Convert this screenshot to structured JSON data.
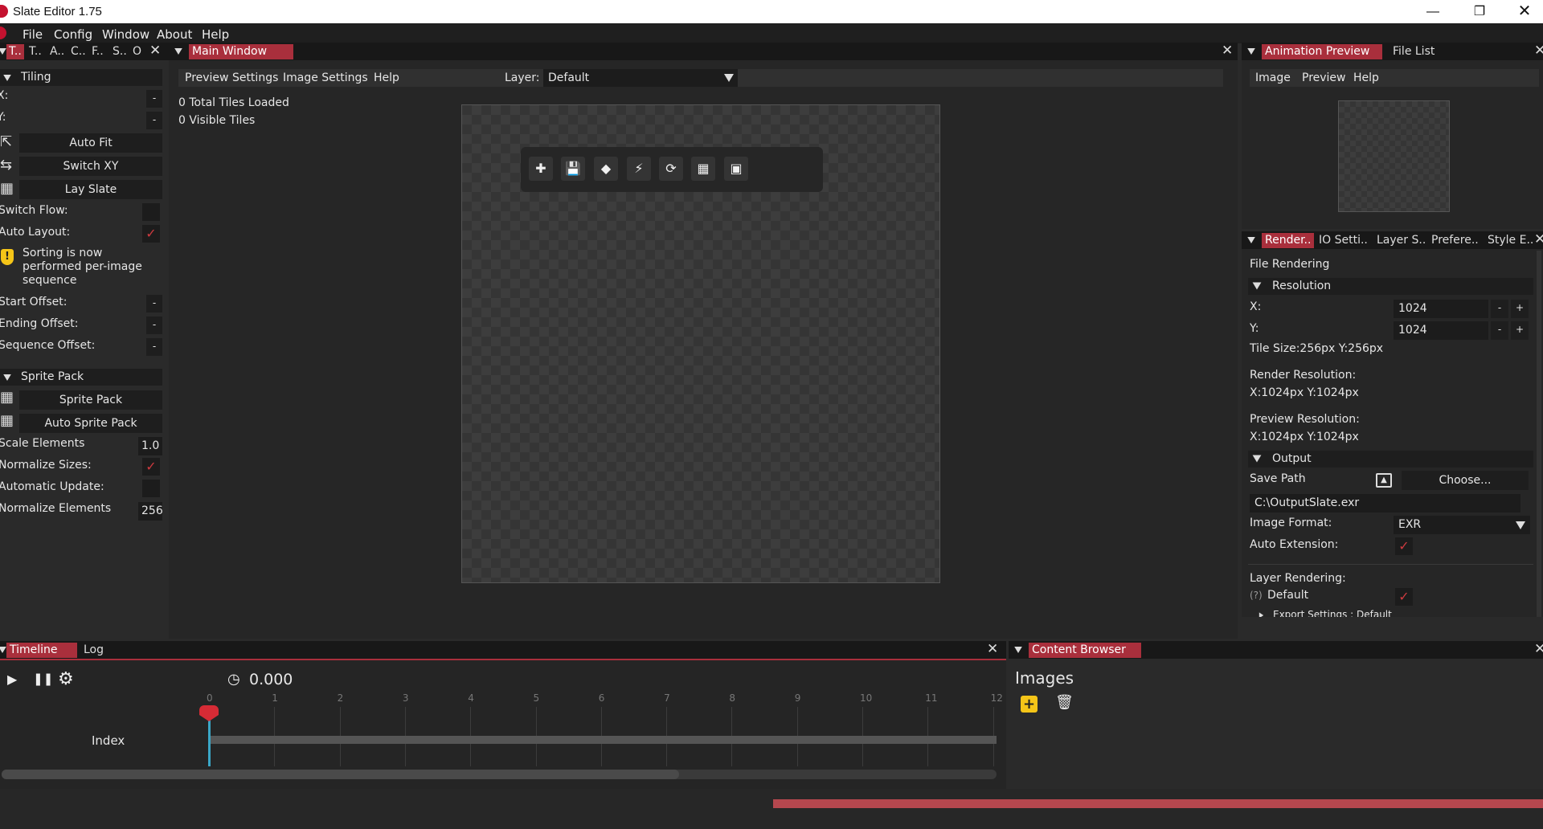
{
  "app": {
    "title": "Slate Editor 1.75"
  },
  "menu": [
    "File",
    "Config",
    "Window",
    "About",
    "Help"
  ],
  "left_tabs": [
    "T..",
    "T..",
    "A..",
    "C..",
    "F..",
    "S..",
    "O"
  ],
  "tiling": {
    "header": "Tiling",
    "x_label": "X:",
    "y_label": "Y:",
    "minus": "-",
    "auto_fit": "Auto Fit",
    "switch_xy": "Switch XY",
    "lay_slate": "Lay Slate",
    "switch_flow": "Switch Flow:",
    "auto_layout": "Auto Layout:",
    "warning": "Sorting is now performed per-image sequence",
    "start_offset": "Start Offset:",
    "ending_offset": "Ending Offset:",
    "sequence_offset": "Sequence Offset:"
  },
  "sprite_pack": {
    "header": "Sprite Pack",
    "sprite_pack_btn": "Sprite Pack",
    "auto_sprite_pack_btn": "Auto Sprite Pack",
    "scale_elements": "Scale Elements",
    "scale_value": "1.0",
    "normalize_sizes": "Normalize Sizes:",
    "automatic_update": "Automatic Update:",
    "normalize_elements": "Normalize Elements",
    "normalize_value": "256"
  },
  "main_window": {
    "tab": "Main Window",
    "menu": [
      "Preview Settings",
      "Image Settings",
      "Help"
    ],
    "layer_label": "Layer:",
    "layer_value": "Default",
    "tiles_loaded": "0 Total Tiles Loaded",
    "visible_tiles": "0 Visible Tiles"
  },
  "right_top": {
    "tabs": [
      "Animation Preview",
      "File List"
    ],
    "menu": [
      "Image",
      "Preview",
      "Help"
    ]
  },
  "right_panel": {
    "tabs": [
      "Render..",
      "IO Setti..",
      "Layer S..",
      "Prefere..",
      "Style E.."
    ],
    "file_rendering": "File Rendering",
    "resolution_header": "Resolution",
    "x_label": "X:",
    "x_value": "1024",
    "y_label": "Y:",
    "y_value": "1024",
    "minus": "-",
    "plus": "+",
    "tile_size": "Tile Size:256px  Y:256px",
    "render_resolution_label": "Render Resolution:",
    "render_resolution_value": "X:1024px  Y:1024px",
    "preview_resolution_label": "Preview Resolution:",
    "preview_resolution_value": "X:1024px  Y:1024px",
    "output_header": "Output",
    "save_path_label": "Save Path",
    "choose_btn": "Choose...",
    "save_path_value": "C:\\OutputSlate.exr",
    "image_format_label": "Image Format:",
    "image_format_value": "EXR",
    "auto_extension": "Auto Extension:",
    "layer_rendering": "Layer Rendering:",
    "help_marker": "(?)",
    "layer_default": "Default",
    "export_settings": "Export Settings : Default"
  },
  "timeline": {
    "tabs": [
      "Timeline",
      "Log"
    ],
    "time": "0.000",
    "ticks": [
      "0",
      "1",
      "2",
      "3",
      "4",
      "5",
      "6",
      "7",
      "8",
      "9",
      "10",
      "11",
      "12"
    ],
    "index_label": "Index"
  },
  "content_browser": {
    "tab": "Content Browser",
    "title": "Images"
  },
  "colors": {
    "accent": "#a92f3c",
    "check": "#cc3a3f",
    "add_icon": "#f5c518"
  }
}
